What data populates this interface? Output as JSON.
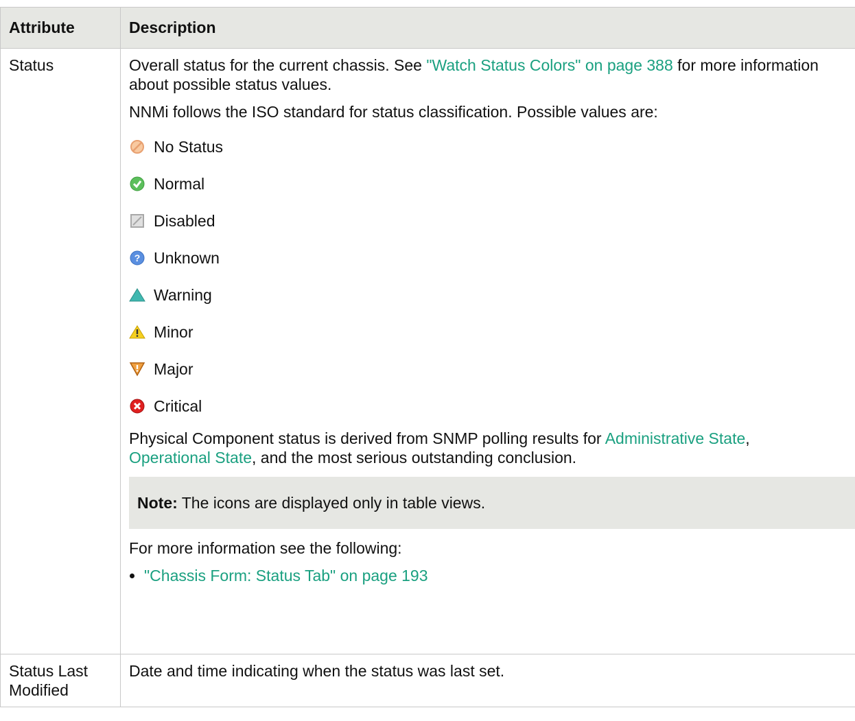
{
  "table": {
    "headers": [
      "Attribute",
      "Description"
    ],
    "rows": {
      "status": {
        "attribute": "Status",
        "intro_text_1": "Overall status for the current chassis. See ",
        "intro_link": "\"Watch Status Colors\" on page 388",
        "intro_text_2": " for more information about possible status values.",
        "iso_text": "NNMi follows the ISO standard for status classification. Possible values are:",
        "status_values": [
          {
            "label": "No Status",
            "icon": "no-status-icon"
          },
          {
            "label": "Normal",
            "icon": "normal-icon"
          },
          {
            "label": "Disabled",
            "icon": "disabled-icon"
          },
          {
            "label": "Unknown",
            "icon": "unknown-icon"
          },
          {
            "label": "Warning",
            "icon": "warning-icon"
          },
          {
            "label": "Minor",
            "icon": "minor-icon"
          },
          {
            "label": "Major",
            "icon": "major-icon"
          },
          {
            "label": "Critical",
            "icon": "critical-icon"
          }
        ],
        "derived_text_1": "Physical Component status is derived from SNMP polling results for ",
        "derived_link_1": "Administrative State",
        "derived_text_2": ",",
        "derived_link_2": "Operational State",
        "derived_text_3": ", and the most serious outstanding conclusion.",
        "note_label": "Note:",
        "note_text": " The icons are displayed only in table views.",
        "more_info_text": "For more information see the following:",
        "more_info_link": "\"Chassis Form: Status Tab\" on page 193"
      },
      "status_last_modified": {
        "attribute": "Status Last Modified",
        "description": "Date and time indicating when the status was last set."
      }
    }
  },
  "colors": {
    "link": "#1aa080",
    "header_bg": "#e6e7e3",
    "note_bg": "#e6e7e3",
    "border": "#c8c8c8"
  }
}
